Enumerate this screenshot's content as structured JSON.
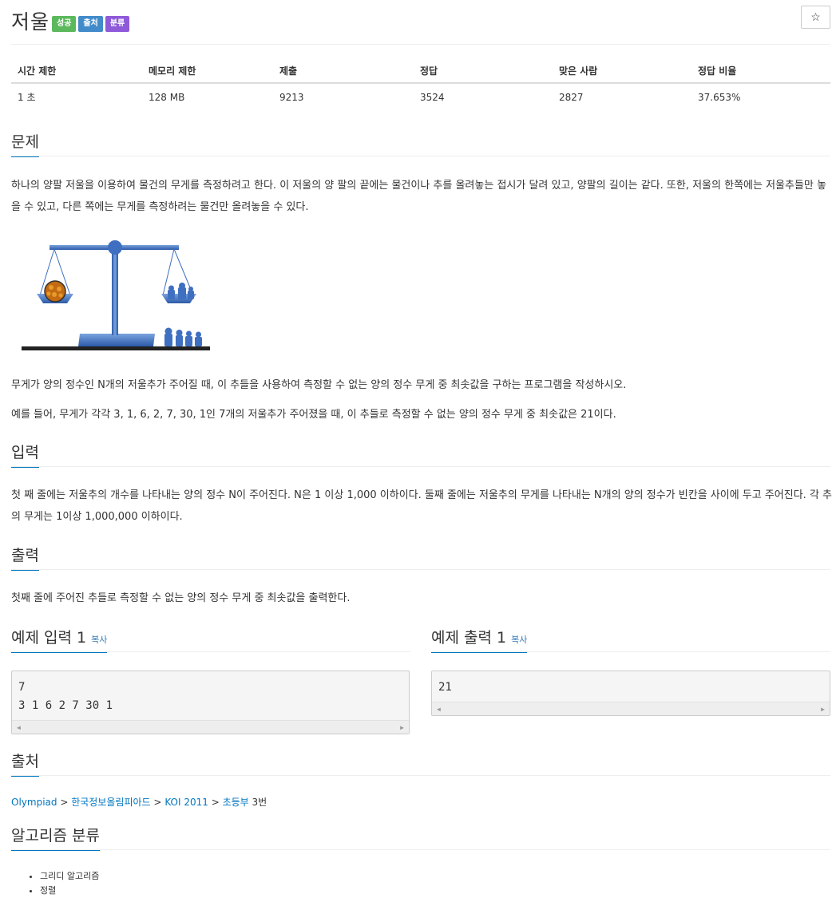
{
  "problem": {
    "title": "저울",
    "labels": [
      {
        "text": "성공",
        "color": "#5cb85c"
      },
      {
        "text": "출처",
        "color": "#428bca"
      },
      {
        "text": "분류",
        "color": "#8e5ad9"
      }
    ],
    "star_icon": "star-icon"
  },
  "info_table": {
    "headers": [
      "시간 제한",
      "메모리 제한",
      "제출",
      "정답",
      "맞은 사람",
      "정답 비율"
    ],
    "values": [
      "1 초",
      "128 MB",
      "9213",
      "3524",
      "2827",
      "37.653%"
    ]
  },
  "sections": {
    "description": {
      "title": "문제",
      "p1": "하나의 양팔 저울을 이용하여 물건의 무게를 측정하려고 한다. 이 저울의 양 팔의 끝에는 물건이나 추를 올려놓는 접시가 달려 있고, 양팔의 길이는 같다. 또한, 저울의 한쪽에는 저울추들만 놓을 수 있고, 다른 쪽에는 무게를 측정하려는 물건만 올려놓을 수 있다.",
      "p2": "무게가 양의 정수인 N개의 저울추가 주어질 때, 이 추들을 사용하여 측정할 수 없는 양의 정수 무게 중 최솟값을 구하는 프로그램을 작성하시오.",
      "p3": "예를 들어, 무게가 각각 3, 1, 6, 2, 7, 30, 1인 7개의 저울추가 주어졌을 때, 이 추들로 측정할 수 없는 양의 정수 무게 중 최솟값은 21이다."
    },
    "input": {
      "title": "입력",
      "text": "첫 째 줄에는 저울추의 개수를 나타내는 양의 정수 N이 주어진다. N은 1 이상 1,000 이하이다. 둘째 줄에는 저울추의 무게를 나타내는 N개의 양의 정수가 빈칸을 사이에 두고 주어진다. 각 추의 무게는 1이상 1,000,000 이하이다."
    },
    "output": {
      "title": "출력",
      "text": "첫째 줄에 주어진 추들로 측정할 수 없는 양의 정수 무게 중 최솟값을 출력한다."
    },
    "sample_input": {
      "title": "예제 입력 1",
      "copy": "복사",
      "content": "7\n3 1 6 2 7 30 1"
    },
    "sample_output": {
      "title": "예제 출력 1",
      "copy": "복사",
      "content": "21"
    },
    "source": {
      "title": "출처",
      "links": [
        "Olympiad",
        "한국정보올림피아드",
        "KOI 2011",
        "초등부"
      ],
      "separator": ">",
      "suffix": "3번"
    },
    "algorithm": {
      "title": "알고리즘 분류",
      "items": [
        "그리디 알고리즘",
        "정렬"
      ]
    }
  }
}
